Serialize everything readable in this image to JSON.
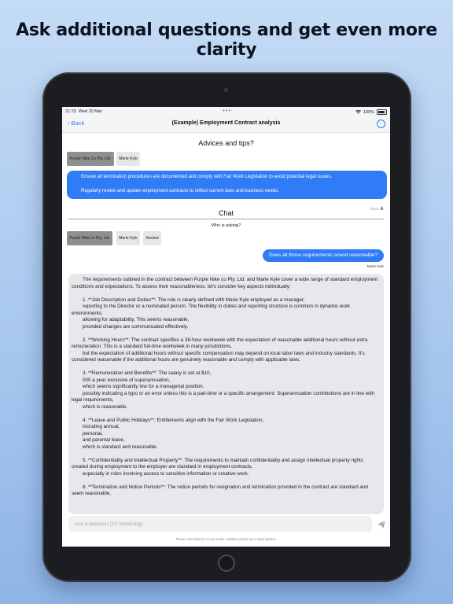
{
  "headline": "Ask additional questions and get even more clarity",
  "colors": {
    "accent": "#2f7cf6",
    "chip_selected": "#8e8e93",
    "chip": "#e5e5ea"
  },
  "status_bar": {
    "time": "21:25",
    "date": "Wed 20 Mar",
    "battery": "100%"
  },
  "nav": {
    "back_label": "Back",
    "title": "(Example) Employment Contract analysis",
    "more_icon": "ellipsis-circle-icon"
  },
  "advices": {
    "heading": "Advices and tips?",
    "chips": [
      "Purple Nike Co Pty. Ltd.",
      "Marie Kyle"
    ],
    "lines": [
      "Ensure all termination procedures are documented and comply with Fair Work Legislation to avoid potential legal issues.",
      "Regularly review and update employment contracts to reflect current laws and business needs."
    ],
    "share_label": "share"
  },
  "chat": {
    "heading": "Chat",
    "who_asking": "Who is asking?",
    "chips": [
      "Purple Nike co Pty. Ltd.",
      "Marie Kyle",
      "Neutral"
    ],
    "user_message": "Does all those requirements sound reasonable?",
    "user_name": "Marie Kyle",
    "reply": "        The requirements outlined in the contract between Purple Nike co Pty. Ltd. and Marie Kyle cover a wide range of standard employment conditions and expectations. To assess their reasonableness, let's consider key aspects individually:\n\n        1. **Job Description and Duties**: The role is clearly defined with Marie Kyle employed as a manager,\n        reporting to the Director or a nominated person. The flexibility in duties and reporting structure is common in dynamic work environments,\n        allowing for adaptability. This seems reasonable,\n        provided changes are communicated effectively.\n\n        2. **Working Hours**: The contract specifies a 38-hour workweek with the expectation of reasonable additional hours without extra remuneration. This is a standard full-time workweek in many jurisdictions,\n        but the expectation of additional hours without specific compensation may depend on local labor laws and industry standards. It's considered reasonable if the additional hours are genuinely reasonable and comply with applicable laws.\n\n        3. **Remuneration and Benefits**: The salary is set at $10,\n        000 a year exclusive of superannuation,\n        which seems significantly low for a managerial position,\n        possibly indicating a typo or an error unless this is a part-time or a specific arrangement. Superannuation contributions are in line with legal requirements,\n        which is reasonable.\n\n        4. **Leave and Public Holidays**: Entitlements align with the Fair Work Legislation,\n        including annual,\n        personal,\n        and parental leave,\n        which is standard and reasonable.\n\n        5. **Confidentiality and Intellectual Property**: The requirements to maintain confidentiality and assign intellectual property rights created during employment to the employer are standard in employment contracts,\n        especially in roles involving access to sensitive information or creative work.\n\n        6. **Termination and Notice Periods**: The notice periods for resignation and termination provided in the contract are standard and seem reasonable,"
  },
  "composer": {
    "placeholder": "Ask a question (10 remaining)",
    "send_icon": "paper-plane-icon"
  },
  "disclaimer": "Please note that the AI can make mistakes and is not a legal advisor."
}
